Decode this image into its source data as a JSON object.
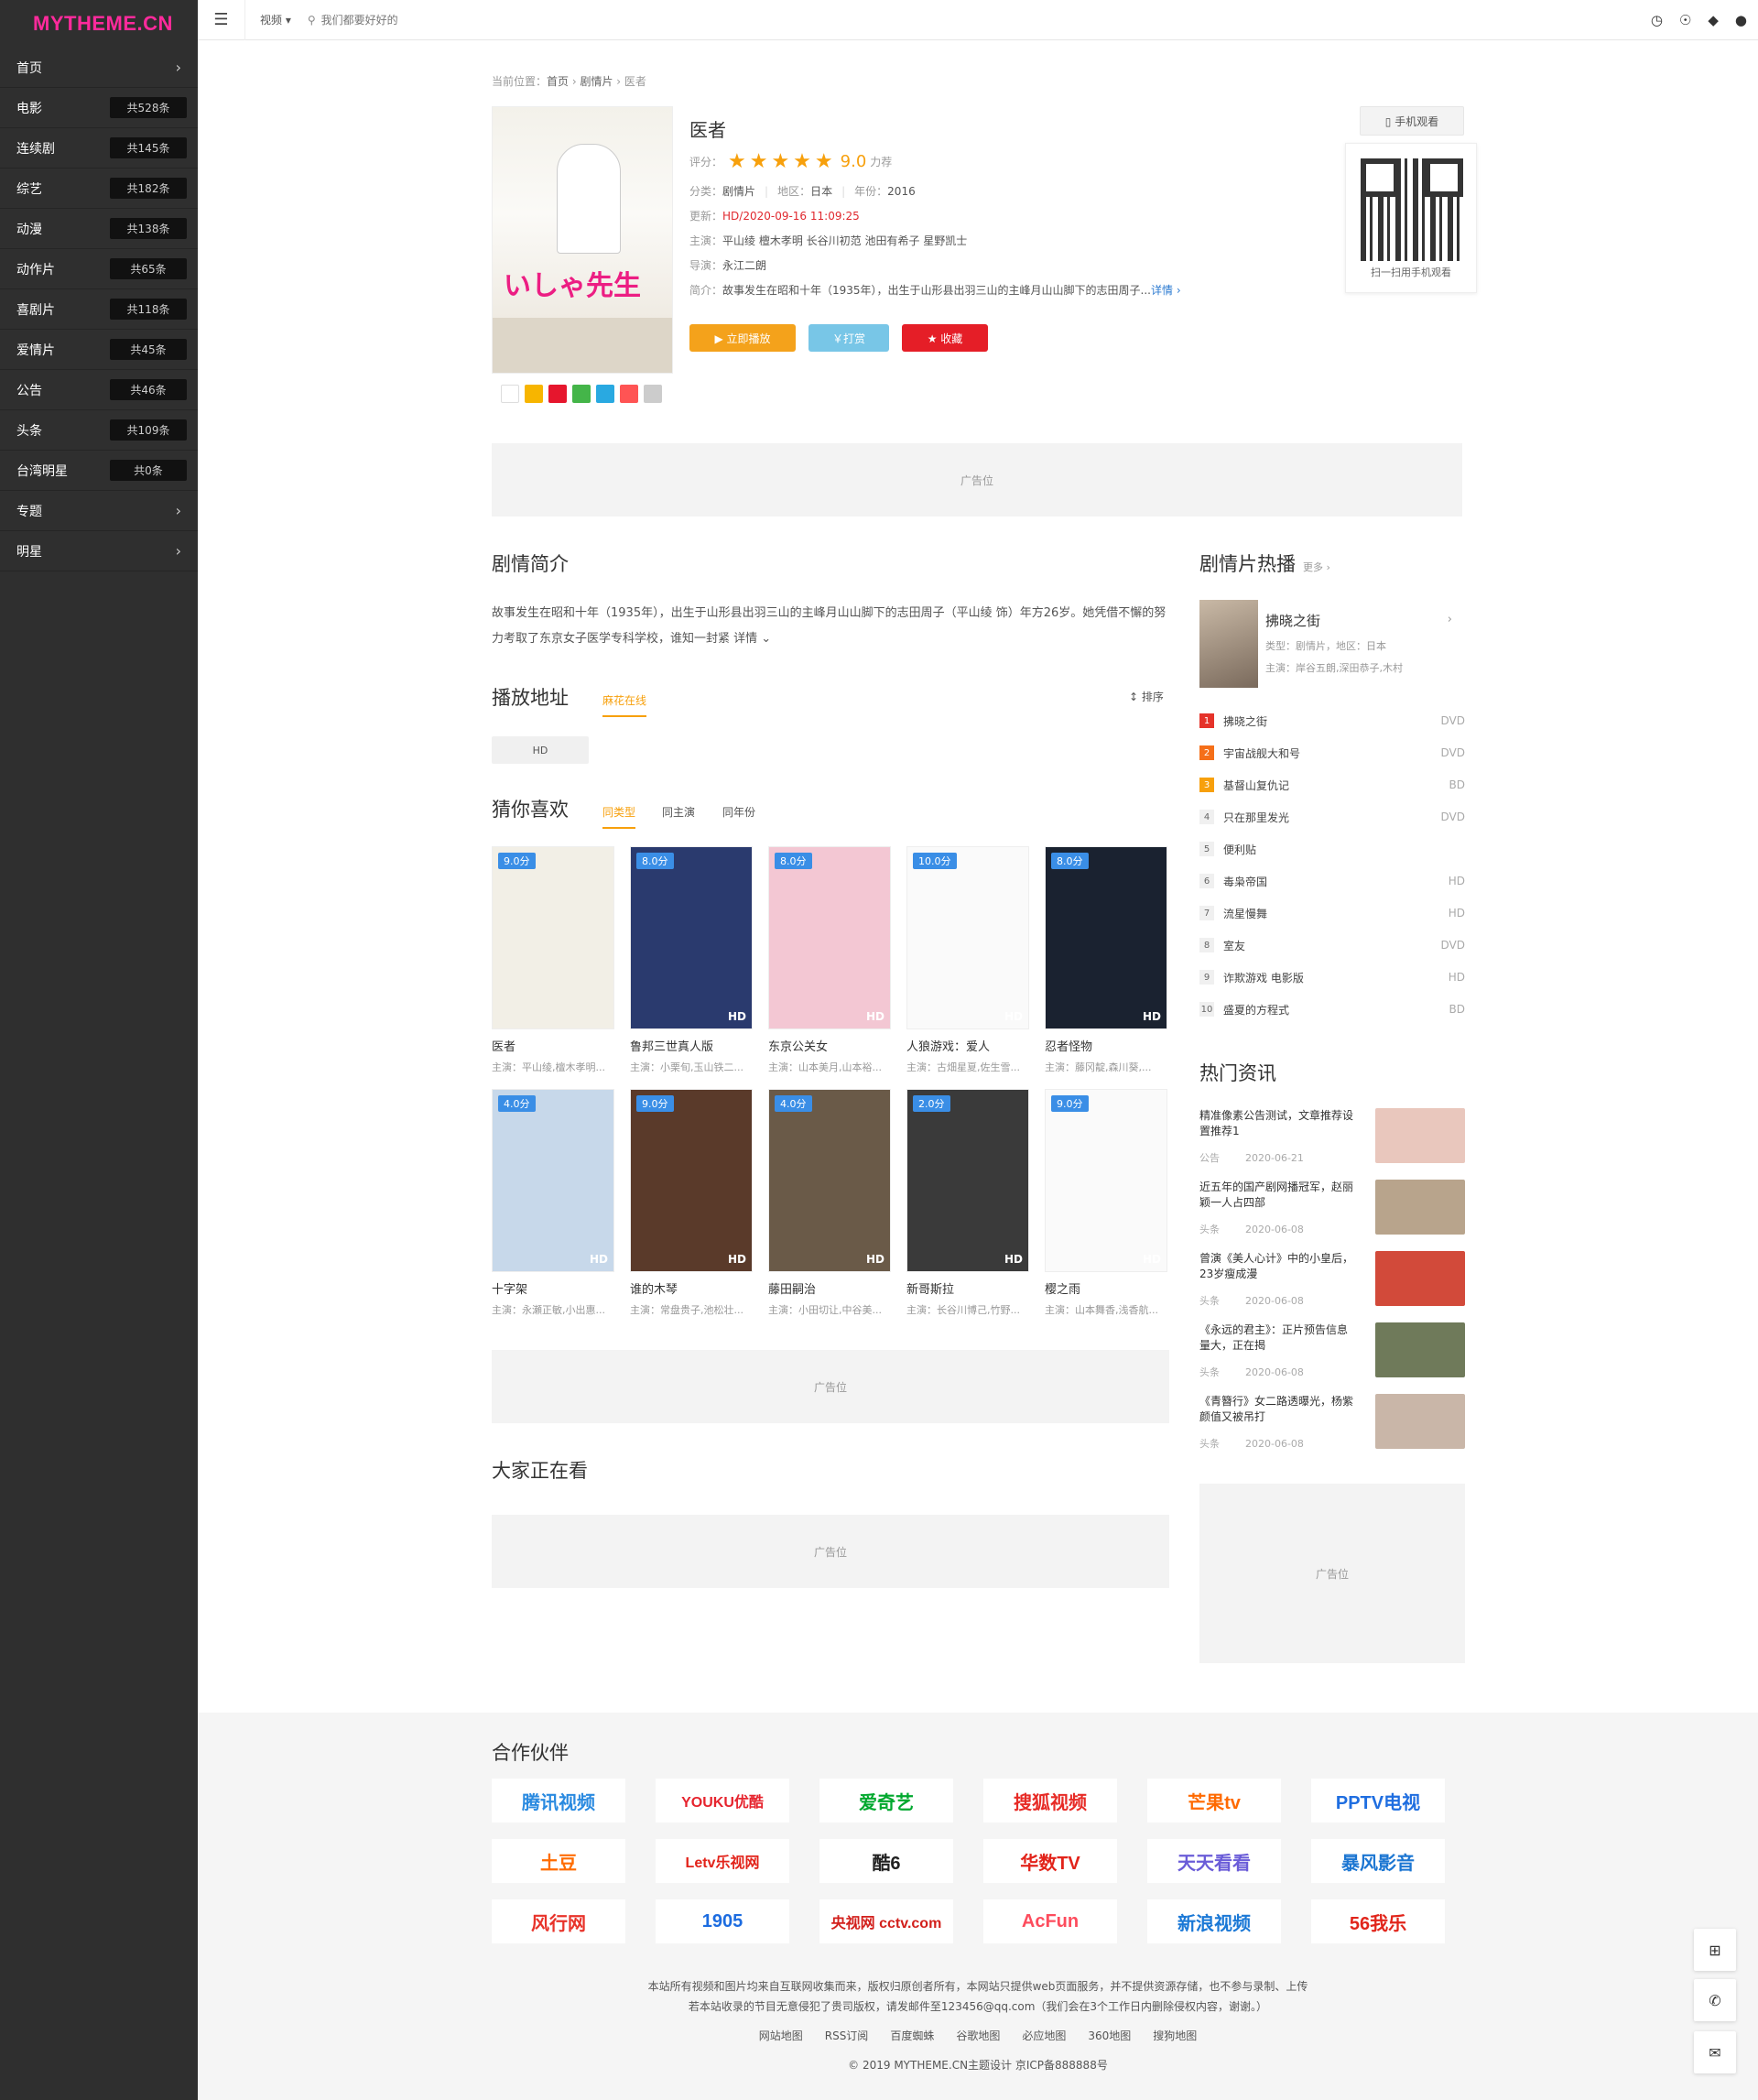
{
  "site": {
    "logo": "MYTHEME.CN"
  },
  "topbar": {
    "search_type": "视频 ▾",
    "search_placeholder": "我们都要好好的"
  },
  "nav": [
    {
      "label": "首页",
      "count": "",
      "arrow": "›"
    },
    {
      "label": "电影",
      "count": "共528条",
      "arrow": ""
    },
    {
      "label": "连续剧",
      "count": "共145条",
      "arrow": ""
    },
    {
      "label": "综艺",
      "count": "共182条",
      "arrow": ""
    },
    {
      "label": "动漫",
      "count": "共138条",
      "arrow": ""
    },
    {
      "label": "动作片",
      "count": "共65条",
      "arrow": ""
    },
    {
      "label": "喜剧片",
      "count": "共118条",
      "arrow": ""
    },
    {
      "label": "爱情片",
      "count": "共45条",
      "arrow": ""
    },
    {
      "label": "公告",
      "count": "共46条",
      "arrow": ""
    },
    {
      "label": "头条",
      "count": "共109条",
      "arrow": ""
    },
    {
      "label": "台湾明星",
      "count": "共0条",
      "arrow": ""
    },
    {
      "label": "专题",
      "count": "",
      "arrow": "›"
    },
    {
      "label": "明星",
      "count": "",
      "arrow": "›"
    }
  ],
  "breadcrumb": {
    "prefix": "当前位置：",
    "home": "首页",
    "category": "剧情片",
    "current": "医者"
  },
  "detail": {
    "title": "医者",
    "rating_label": "评分：",
    "stars": "★★★★★",
    "score": "9.0",
    "score_note": "力荐",
    "category_label": "分类：",
    "category": "剧情片",
    "region_label": "地区：",
    "region": "日本",
    "year_label": "年份：",
    "year": "2016",
    "update_label": "更新：",
    "update": "HD/2020-09-16 11:09:25",
    "cast_label": "主演：",
    "cast": "平山绫 檀木孝明 长谷川初范 池田有希子 星野凯士",
    "director_label": "导演：",
    "director": "永江二朗",
    "intro_label": "简介：",
    "intro": "故事发生在昭和十年（1935年），出生于山形县出羽三山的主峰月山山脚下的志田周子...",
    "intro_more": "详情 ›",
    "poster_text": "いしゃ先生"
  },
  "actions": {
    "play": "▶ 立即播放",
    "tip": "￥打赏",
    "fav": "★ 收藏",
    "mobile": "▯ 手机观看",
    "qr_caption": "扫一扫用手机观看"
  },
  "ad_label": "广告位",
  "synopsis": {
    "title": "剧情简介",
    "text": "故事发生在昭和十年（1935年），出生于山形县出羽三山的主峰月山山脚下的志田周子（平山绫 饰）年方26岁。她凭借不懈的努力考取了东京女子医学专科学校，谁知一封紧",
    "more": "详情 ⌄"
  },
  "play": {
    "title": "播放地址",
    "source": "麻花在线",
    "sort": "↕ 排序",
    "hd": "HD"
  },
  "guess": {
    "title": "猜你喜欢",
    "tabs": [
      "同类型",
      "同主演",
      "同年份"
    ],
    "items": [
      {
        "score": "9.0分",
        "name": "医者",
        "cast": "主演：平山绫,檀木孝明...",
        "q": "",
        "color": "#f2efe6"
      },
      {
        "score": "8.0分",
        "name": "鲁邦三世真人版",
        "cast": "主演：小栗旬,玉山铁二...",
        "q": "HD",
        "color": "#2a3a6e"
      },
      {
        "score": "8.0分",
        "name": "东京公关女",
        "cast": "主演：山本美月,山本裕...",
        "q": "HD",
        "color": "#f3c7d3"
      },
      {
        "score": "10.0分",
        "name": "人狼游戏：爱人",
        "cast": "主演：古畑星夏,佐生雪...",
        "q": "HD",
        "color": "#fafafa"
      },
      {
        "score": "8.0分",
        "name": "忍者怪物",
        "cast": "主演：藤冈靛,森川葵,...",
        "q": "HD",
        "color": "#1a2230"
      },
      {
        "score": "4.0分",
        "name": "十字架",
        "cast": "主演：永瀬正敏,小出惠...",
        "q": "HD",
        "color": "#c7d8ea"
      },
      {
        "score": "9.0分",
        "name": "谁的木琴",
        "cast": "主演：常盘贵子,池松壮...",
        "q": "HD",
        "color": "#5a3a2a"
      },
      {
        "score": "4.0分",
        "name": "藤田嗣治",
        "cast": "主演：小田切让,中谷美...",
        "q": "HD",
        "color": "#6a5a48"
      },
      {
        "score": "2.0分",
        "name": "新哥斯拉",
        "cast": "主演：长谷川博己,竹野...",
        "q": "HD",
        "color": "#3a3a3a"
      },
      {
        "score": "9.0分",
        "name": "樱之雨",
        "cast": "主演：山本舞香,浅香航...",
        "q": "HD",
        "color": "#fafafa"
      }
    ]
  },
  "watching": {
    "title": "大家正在看"
  },
  "hot": {
    "title": "剧情片热播",
    "more": "更多 ›",
    "feature": {
      "name": "拂晓之街",
      "line1": "类型：剧情片，地区：日本",
      "line2": "主演：岸谷五朗,深田恭子,木村"
    },
    "ranks": [
      {
        "n": "1",
        "name": "拂晓之街",
        "tag": "DVD"
      },
      {
        "n": "2",
        "name": "宇宙战舰大和号",
        "tag": "DVD"
      },
      {
        "n": "3",
        "name": "基督山复仇记",
        "tag": "BD"
      },
      {
        "n": "4",
        "name": "只在那里发光",
        "tag": "DVD"
      },
      {
        "n": "5",
        "name": "便利贴",
        "tag": ""
      },
      {
        "n": "6",
        "name": "毒枭帝国",
        "tag": "HD"
      },
      {
        "n": "7",
        "name": "流星慢舞",
        "tag": "HD"
      },
      {
        "n": "8",
        "name": "室友",
        "tag": "DVD"
      },
      {
        "n": "9",
        "name": "诈欺游戏 电影版",
        "tag": "HD"
      },
      {
        "n": "10",
        "name": "盛夏的方程式",
        "tag": "BD"
      }
    ]
  },
  "news": {
    "title": "热门资讯",
    "items": [
      {
        "title": "精准像素公告测试，文章推荐设置推荐1",
        "cat": "公告",
        "date": "2020-06-21",
        "color": "#e9c7bd"
      },
      {
        "title": "近五年的国产剧网播冠军，赵丽颖一人占四部",
        "cat": "头条",
        "date": "2020-06-08",
        "color": "#b8a48c"
      },
      {
        "title": "曾演《美人心计》中的小皇后，23岁瘦成漫",
        "cat": "头条",
        "date": "2020-06-08",
        "color": "#d24a3a"
      },
      {
        "title": "《永远的君主》：正片预告信息量大，正在揭",
        "cat": "头条",
        "date": "2020-06-08",
        "color": "#6f7a5a"
      },
      {
        "title": "《青簪行》女二路透曝光，杨紫颜值又被吊打",
        "cat": "头条",
        "date": "2020-06-08",
        "color": "#c9b6a8"
      }
    ]
  },
  "partners": {
    "title": "合作伙伴",
    "items": [
      {
        "name": "腾讯视频",
        "color": "#2a8ae0"
      },
      {
        "name": "YOUKU优酷",
        "color": "#e6242e"
      },
      {
        "name": "爱奇艺",
        "color": "#00a82e"
      },
      {
        "name": "搜狐视频",
        "color": "#e72b26"
      },
      {
        "name": "芒果tv",
        "color": "#ff6a00"
      },
      {
        "name": "PPTV电视",
        "color": "#1f6ee0"
      },
      {
        "name": "土豆",
        "color": "#ff6c00"
      },
      {
        "name": "Letv乐视网",
        "color": "#e2231a"
      },
      {
        "name": "酷6",
        "color": "#222222"
      },
      {
        "name": "华数TV",
        "color": "#e2231a"
      },
      {
        "name": "天天看看",
        "color": "#6a5cd8"
      },
      {
        "name": "暴风影音",
        "color": "#1c76d2"
      },
      {
        "name": "风行网",
        "color": "#e8332a"
      },
      {
        "name": "1905",
        "color": "#1c6ce0"
      },
      {
        "name": "央视网 cctv.com",
        "color": "#d2201c"
      },
      {
        "name": "AcFun",
        "color": "#fd4c5d"
      },
      {
        "name": "新浪视频",
        "color": "#1a78d6"
      },
      {
        "name": "56我乐",
        "color": "#e1251b"
      }
    ]
  },
  "footer": {
    "line1": "本站所有视频和图片均来自互联网收集而来，版权归原创者所有，本网站只提供web页面服务，并不提供资源存储，也不参与录制、上传",
    "line2": "若本站收录的节目无意侵犯了贵司版权，请发邮件至123456@qq.com（我们会在3个工作日内删除侵权内容，谢谢。）",
    "links": [
      "网站地图",
      "RSS订阅",
      "百度蜘蛛",
      "谷歌地图",
      "必应地图",
      "360地图",
      "搜狗地图"
    ],
    "copyright": "© 2019 MYTHEME.CN主题设计 京ICP备888888号"
  }
}
